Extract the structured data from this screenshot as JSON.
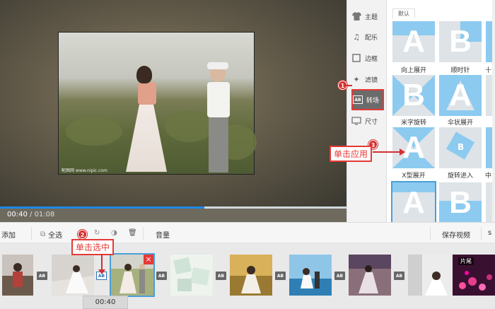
{
  "preview": {
    "watermark": "昵图网 www.nipic.com",
    "time_current": "00:40",
    "time_sep": " / ",
    "time_total": "01:08",
    "progress_fraction": 0.59
  },
  "side_tabs": [
    {
      "label": "主题",
      "icon": "shirt-icon"
    },
    {
      "label": "配乐",
      "icon": "music-note-icon"
    },
    {
      "label": "边框",
      "icon": "frame-icon"
    },
    {
      "label": "滤镜",
      "icon": "filter-wand-icon"
    },
    {
      "label": "转场",
      "icon": "transition-ab-icon",
      "active": true
    },
    {
      "label": "尺寸",
      "icon": "screen-size-icon"
    }
  ],
  "transitions": {
    "tab_label": "默认",
    "labels": [
      "向上展开",
      "顺时针",
      "米字旋转",
      "伞状展开",
      "X型展开",
      "旋转进入",
      "十",
      "中"
    ]
  },
  "toolbar": {
    "add": "添加",
    "select_all": "全选",
    "volume": "音量",
    "save_video": "保存视频",
    "right_cut": "ѕ"
  },
  "strip": {
    "tail_label": "片尾",
    "time": "00:40"
  },
  "annotations": {
    "step1": "1",
    "step2": "2",
    "step3": "3",
    "click_select": "单击选中",
    "click_apply": "单击应用"
  },
  "colors": {
    "accent": "#4a9fd8",
    "highlight_red": "#e53935",
    "tile_blue": "#8ccaf0"
  }
}
